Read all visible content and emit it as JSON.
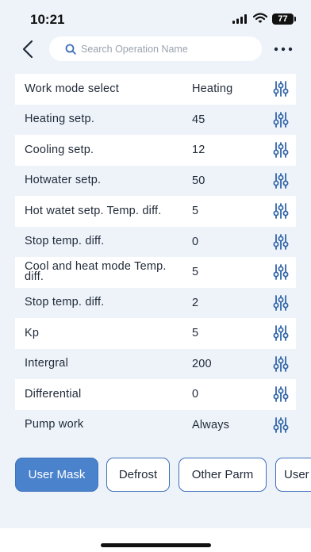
{
  "status_bar": {
    "time": "10:21",
    "battery": "77"
  },
  "search": {
    "placeholder": "Search Operation Name",
    "value": ""
  },
  "params": [
    {
      "name": "Work mode select",
      "value": "Heating"
    },
    {
      "name": "Heating setp.",
      "value": "45"
    },
    {
      "name": "Cooling setp.",
      "value": "12"
    },
    {
      "name": "Hotwater setp.",
      "value": "50"
    },
    {
      "name": "Hot watet setp. Temp. diff.",
      "value": "5"
    },
    {
      "name": "Stop temp. diff.",
      "value": "0"
    },
    {
      "name": "Cool and heat mode Temp. diff.",
      "value": "5"
    },
    {
      "name": "Stop temp. diff.",
      "value": "2"
    },
    {
      "name": "Kp",
      "value": "5"
    },
    {
      "name": "Intergral",
      "value": "200"
    },
    {
      "name": "Differential",
      "value": "0"
    },
    {
      "name": "Pump work",
      "value": "Always"
    }
  ],
  "tabs": [
    {
      "label": "User Mask",
      "active": true
    },
    {
      "label": "Defrost",
      "active": false
    },
    {
      "label": "Other Parm",
      "active": false
    },
    {
      "label": "User",
      "active": false
    }
  ],
  "colors": {
    "accent": "#4a82cc",
    "icon_blue": "#3366a8",
    "background": "#eef3fa"
  }
}
